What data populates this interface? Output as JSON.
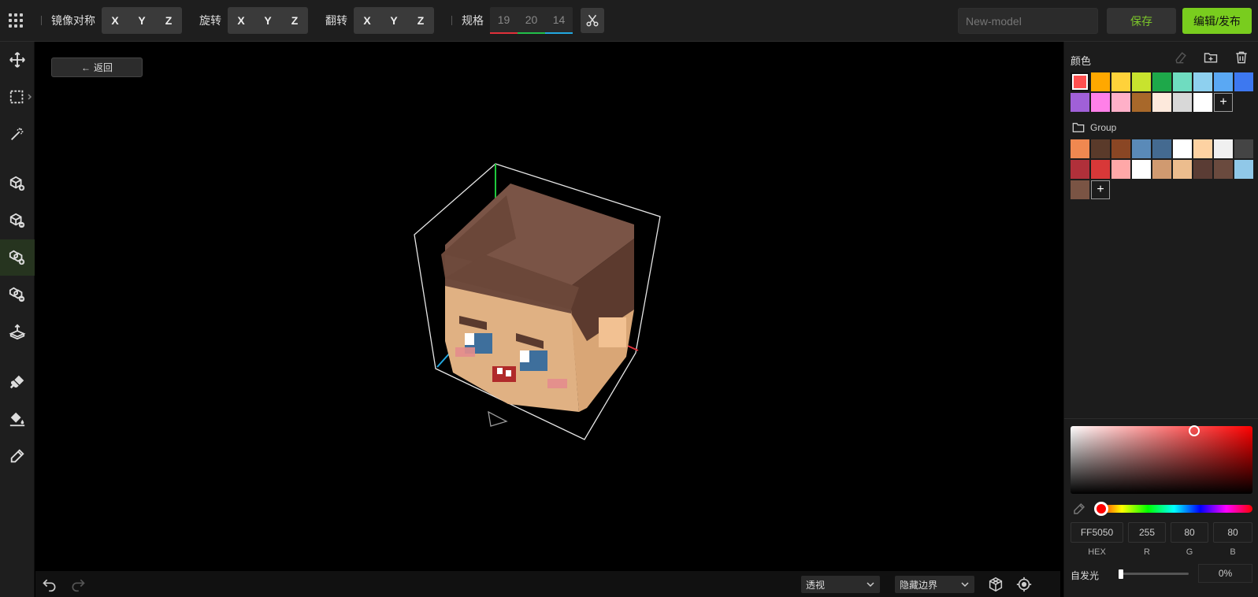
{
  "toolbar": {
    "mirror_label": "镜像对称",
    "rotate_label": "旋转",
    "flip_label": "翻转",
    "size_label": "规格",
    "axes": [
      "X",
      "Y",
      "Z"
    ],
    "size": {
      "x": "19",
      "y": "20",
      "z": "14"
    },
    "size_colors": [
      "#e0303a",
      "#22c04a",
      "#22a8e0"
    ],
    "model_name_placeholder": "New-model",
    "save_label": "保存",
    "publish_label": "编辑/发布"
  },
  "viewport": {
    "back_label": "返回",
    "back_arrow": "←"
  },
  "bottombar": {
    "view_mode": "透视",
    "boundary_mode": "隐藏边界"
  },
  "palette": {
    "title": "颜色",
    "colors": [
      "#ff5050",
      "#ffa800",
      "#ffd23a",
      "#c8e32e",
      "#1ea84a",
      "#6fdcc0",
      "#8ed0ef",
      "#5aa8f3",
      "#3d78f0",
      "#a060d8",
      "#ff80e8",
      "#ffb0c8",
      "#a8682a",
      "#fde9dc",
      "#d8d8d8",
      "#ffffff"
    ],
    "selected_index": 0,
    "group_name": "Group",
    "group_colors": [
      "#f08850",
      "#5a3a2a",
      "#8a4624",
      "#5a8ab8",
      "#446a90",
      "#ffffff",
      "#fdd2a2",
      "#f0f0f0",
      "#444444",
      "#b0303a",
      "#d83838",
      "#ffa8a8",
      "#ffffff",
      "#d09a70",
      "#ecbd8e",
      "#5a3c34",
      "#6a4a3e",
      "#90c8e8",
      "#7a5444"
    ]
  },
  "color_picker": {
    "hex": "FF5050",
    "r": "255",
    "g": "80",
    "b": "80",
    "hex_label": "HEX",
    "r_label": "R",
    "g_label": "G",
    "b_label": "B",
    "emission_label": "自发光",
    "emission_value": "0%",
    "emission_level": 0
  }
}
